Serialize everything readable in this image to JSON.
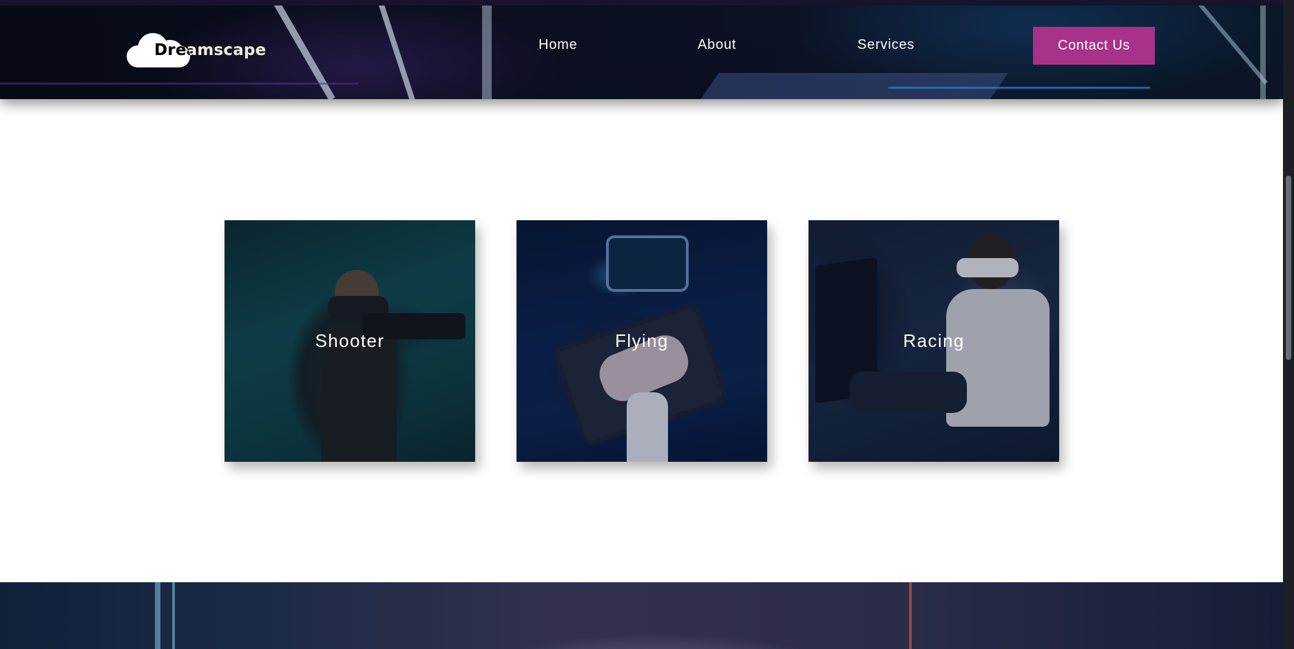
{
  "brand": {
    "name": "Dreamscape",
    "logo_icon": "cloud-icon"
  },
  "nav": {
    "home_label": "Home",
    "about_label": "About",
    "services_label": "Services",
    "contact_label": "Contact Us"
  },
  "cards": [
    {
      "title": "Shooter"
    },
    {
      "title": "Flying"
    },
    {
      "title": "Racing"
    }
  ],
  "colors": {
    "accent": "#a83289",
    "background": "#ffffff",
    "header_dark": "#0a0f20"
  }
}
